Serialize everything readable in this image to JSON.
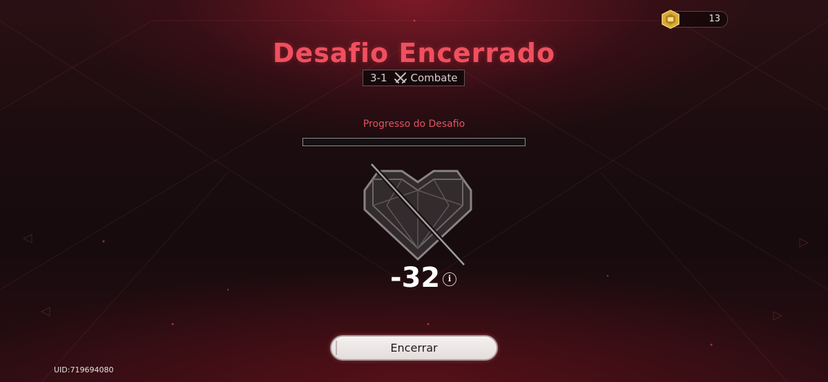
{
  "currency": {
    "icon": "gold-coin-icon",
    "value": "13"
  },
  "result": {
    "title": "Desafio Encerrado",
    "stage_number": "3-1",
    "stage_icon": "crossed-swords-icon",
    "stage_type": "Combate"
  },
  "progress": {
    "label": "Progresso do Desafio",
    "value": 0
  },
  "health": {
    "icon": "broken-heart-icon",
    "score": "-32",
    "info_icon": "info-icon",
    "info_glyph": "i"
  },
  "actions": {
    "end_label": "Encerrar"
  },
  "footer": {
    "uid": "UID:719694080"
  },
  "colors": {
    "accent_red": "#f0505f",
    "progress_label": "#e25560",
    "button_bg": "#f0ecec"
  }
}
